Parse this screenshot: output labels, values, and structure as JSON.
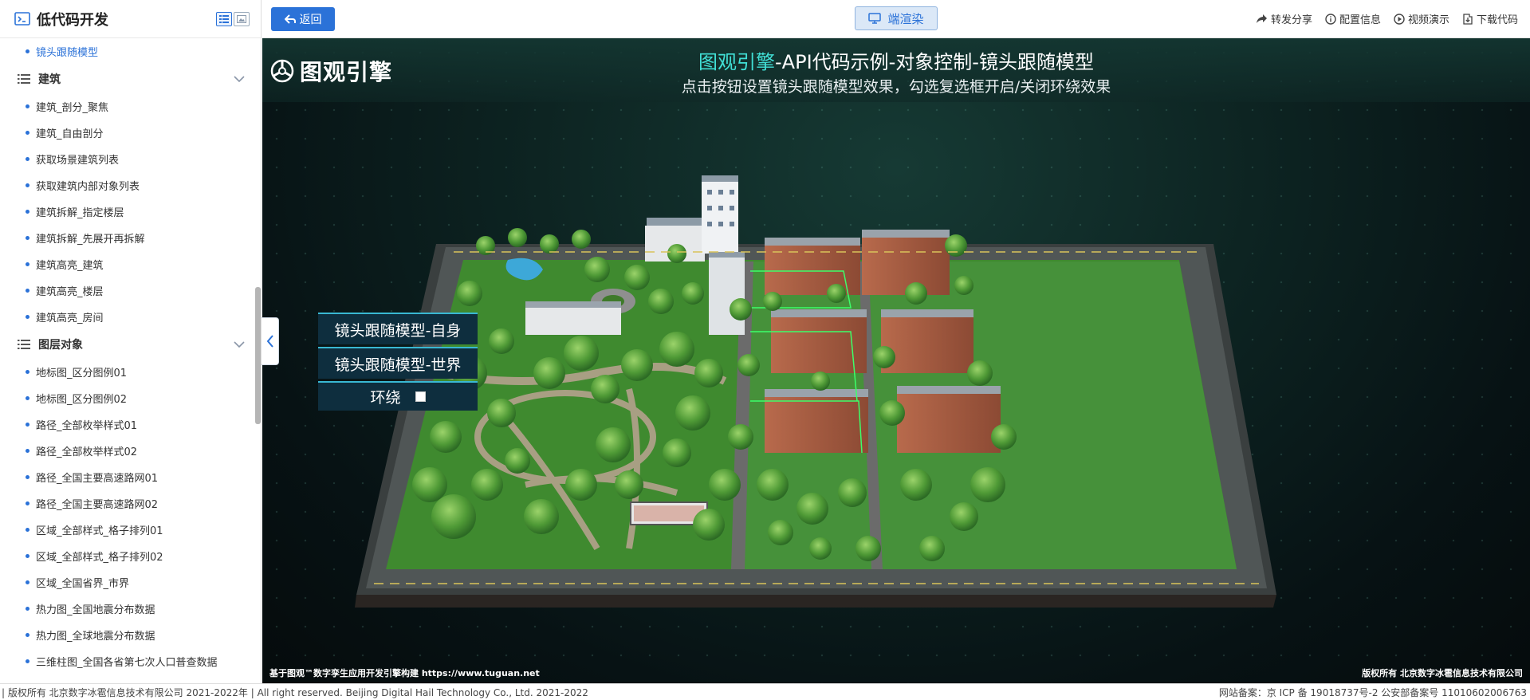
{
  "sidebar": {
    "title": "低代码开发",
    "items": [
      {
        "type": "item",
        "label": "镜头跟随模型",
        "active": true
      },
      {
        "type": "group",
        "label": "建筑"
      },
      {
        "type": "item",
        "label": "建筑_剖分_聚焦"
      },
      {
        "type": "item",
        "label": "建筑_自由剖分"
      },
      {
        "type": "item",
        "label": "获取场景建筑列表"
      },
      {
        "type": "item",
        "label": "获取建筑内部对象列表"
      },
      {
        "type": "item",
        "label": "建筑拆解_指定楼层"
      },
      {
        "type": "item",
        "label": "建筑拆解_先展开再拆解"
      },
      {
        "type": "item",
        "label": "建筑高亮_建筑"
      },
      {
        "type": "item",
        "label": "建筑高亮_楼层"
      },
      {
        "type": "item",
        "label": "建筑高亮_房间"
      },
      {
        "type": "group",
        "label": "图层对象"
      },
      {
        "type": "item",
        "label": "地标图_区分图例01"
      },
      {
        "type": "item",
        "label": "地标图_区分图例02"
      },
      {
        "type": "item",
        "label": "路径_全部枚举样式01"
      },
      {
        "type": "item",
        "label": "路径_全部枚举样式02"
      },
      {
        "type": "item",
        "label": "路径_全国主要高速路网01"
      },
      {
        "type": "item",
        "label": "路径_全国主要高速路网02"
      },
      {
        "type": "item",
        "label": "区域_全部样式_格子排列01"
      },
      {
        "type": "item",
        "label": "区域_全部样式_格子排列02"
      },
      {
        "type": "item",
        "label": "区域_全国省界_市界"
      },
      {
        "type": "item",
        "label": "热力图_全国地震分布数据"
      },
      {
        "type": "item",
        "label": "热力图_全球地震分布数据"
      },
      {
        "type": "item",
        "label": "三维柱图_全国各省第七次人口普查数据"
      }
    ]
  },
  "topbar": {
    "back_label": "返回",
    "render_label": "端渲染",
    "actions": [
      {
        "label": "转发分享",
        "icon": "share-icon"
      },
      {
        "label": "配置信息",
        "icon": "info-icon"
      },
      {
        "label": "视频演示",
        "icon": "play-icon"
      },
      {
        "label": "下载代码",
        "icon": "download-icon"
      }
    ]
  },
  "viewport": {
    "brand": "图观引擎",
    "title_highlight": "图观引擎",
    "title_rest": "-API代码示例-对象控制-镜头跟随模型",
    "subtitle": "点击按钮设置镜头跟随模型效果，勾选复选框开启/关闭环绕效果",
    "buttons": [
      "镜头跟随模型-自身",
      "镜头跟随模型-世界"
    ],
    "orbit_label": "环绕",
    "orbit_checked": false,
    "footer_left": "基于图观™数字孪生应用开发引擎构建 https://www.tuguan.net",
    "footer_right": "版权所有 北京数字冰雹信息技术有限公司"
  },
  "bottombar": {
    "left": "| 版权所有 北京数字冰雹信息技术有限公司 2021-2022年 | All right reserved. Beijing Digital Hail Technology Co., Ltd. 2021-2022",
    "right": "网站备案：京 ICP 备 19018737号-2 公安部备案号 11010602006763"
  },
  "colors": {
    "accent": "#2b72d8",
    "title_highlight": "#41e0d6",
    "panel_bg": "#0e2e3e",
    "panel_border": "#39b8d3"
  }
}
